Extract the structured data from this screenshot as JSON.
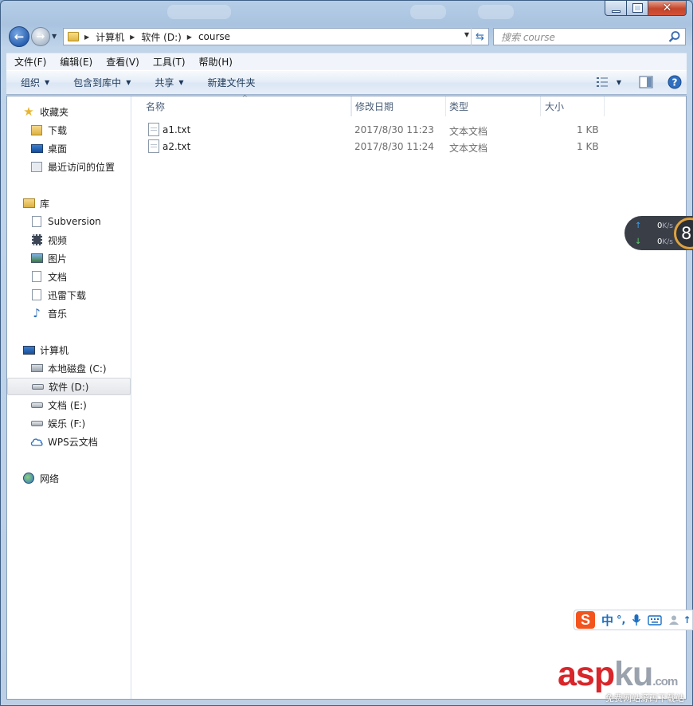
{
  "address_bar": {
    "crumbs": [
      "计算机",
      "软件 (D:)",
      "course"
    ]
  },
  "search": {
    "placeholder": "搜索 course"
  },
  "menu": [
    "文件(F)",
    "编辑(E)",
    "查看(V)",
    "工具(T)",
    "帮助(H)"
  ],
  "toolbar": {
    "organize": "组织",
    "include_in_library": "包含到库中",
    "share": "共享",
    "new_folder": "新建文件夹"
  },
  "sidebar": {
    "favorites": {
      "label": "收藏夹",
      "items": [
        "下载",
        "桌面",
        "最近访问的位置"
      ]
    },
    "libraries": {
      "label": "库",
      "items": [
        "Subversion",
        "视频",
        "图片",
        "文档",
        "迅雷下载",
        "音乐"
      ]
    },
    "computer": {
      "label": "计算机",
      "items": [
        "本地磁盘 (C:)",
        "软件 (D:)",
        "文档 (E:)",
        "娱乐 (F:)",
        "WPS云文档"
      ]
    },
    "network": {
      "label": "网络"
    },
    "selected": "软件 (D:)"
  },
  "file_list": {
    "columns": [
      "名称",
      "修改日期",
      "类型",
      "大小"
    ],
    "rows": [
      {
        "name": "a1.txt",
        "modified": "2017/8/30 11:23",
        "type": "文本文档",
        "size": "1 KB"
      },
      {
        "name": "a2.txt",
        "modified": "2017/8/30 11:24",
        "type": "文本文档",
        "size": "1 KB"
      }
    ]
  },
  "net_monitor": {
    "up": "0",
    "down": "0",
    "unit": "K/s",
    "dial": "8"
  },
  "ime": {
    "mode": "中",
    "punct": "°,"
  },
  "watermark": {
    "brand_a": "asp",
    "brand_b": "ku",
    "suffix": ".com",
    "tagline": "免费网站源码下载站"
  },
  "colors": {
    "accent": "#1e395b",
    "selection": "#e5e6ea",
    "brand_red": "#d8262b"
  }
}
